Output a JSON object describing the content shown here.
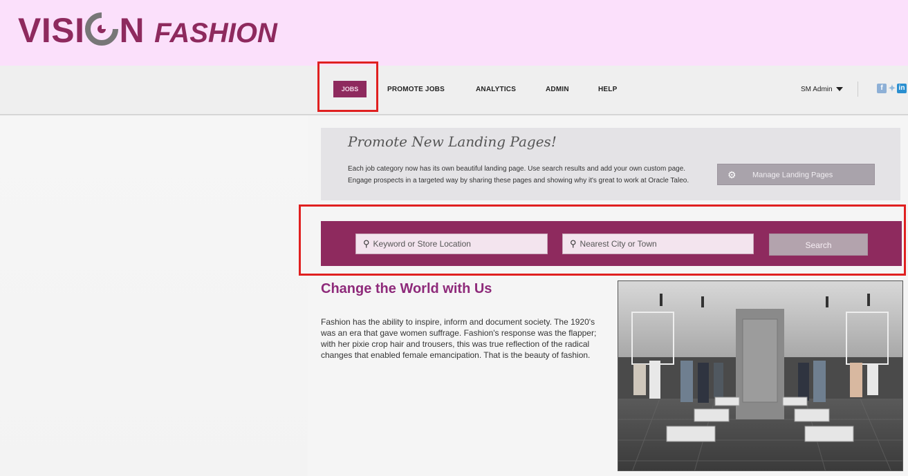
{
  "brand": {
    "word1_pre": "VISI",
    "word1_post": "N",
    "word2": "FASHION"
  },
  "nav": {
    "items": [
      "JOBS",
      "PROMOTE JOBS",
      "ANALYTICS",
      "ADMIN",
      "HELP"
    ],
    "user": "SM Admin",
    "social": {
      "facebook": "f",
      "twitter": "t",
      "linkedin": "in"
    }
  },
  "promo": {
    "title": "Promote New Landing Pages!",
    "text": "Each job category now has its own beautiful landing page. Use search results and add your own custom page. Engage prospects in a targeted way by sharing these pages and showing why it's great to work at Oracle Taleo.",
    "button_label": "Manage Landing Pages"
  },
  "search": {
    "keyword_placeholder": "Keyword or Store Location",
    "location_placeholder": "Nearest City or Town",
    "button_label": "Search"
  },
  "article": {
    "headline": "Change the World with Us",
    "body": "Fashion has the ability to inspire, inform and document society. The 1920's was an era that gave women suffrage. Fashion's response was the flapper; with her pixie crop hair and trousers, this was true reflection of the radical changes that enabled female emancipation. That is the beauty of fashion."
  },
  "colors": {
    "brand": "#8e2a5e",
    "banner": "#fbe0fb",
    "highlight": "#e02020"
  }
}
